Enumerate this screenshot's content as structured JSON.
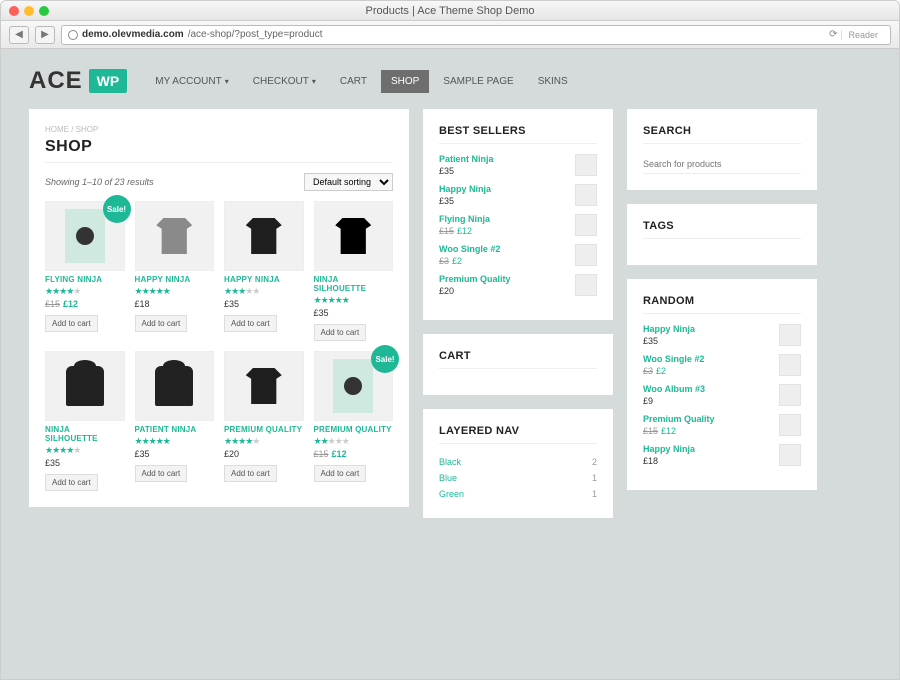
{
  "window": {
    "title": "Products | Ace Theme Shop Demo"
  },
  "url": {
    "host": "demo.olevmedia.com",
    "path": "/ace-shop/?post_type=product",
    "reader": "Reader"
  },
  "logo": {
    "text1": "ACE",
    "text2": "WP"
  },
  "menu": [
    {
      "label": "MY ACCOUNT",
      "dropdown": true
    },
    {
      "label": "CHECKOUT",
      "dropdown": true
    },
    {
      "label": "CART"
    },
    {
      "label": "SHOP",
      "active": true
    },
    {
      "label": "SAMPLE PAGE"
    },
    {
      "label": "SKINS"
    }
  ],
  "breadcrumb": "HOME / SHOP",
  "page_title": "SHOP",
  "results_text": "Showing 1–10 of 23 results",
  "sort_label": "Default sorting",
  "sale_badge": "Sale!",
  "add_to_cart": "Add to cart",
  "products": [
    {
      "name": "FLYING NINJA",
      "stars": 4,
      "old": "£15",
      "new": "£12",
      "sale": true,
      "img": "poster"
    },
    {
      "name": "HAPPY NINJA",
      "stars": 5,
      "price": "£18",
      "img": "tee-grey"
    },
    {
      "name": "HAPPY NINJA",
      "stars": 3,
      "price": "£35",
      "img": "tee-dark"
    },
    {
      "name": "NINJA SILHOUETTE",
      "stars": 5,
      "price": "£35",
      "img": "tee-black"
    },
    {
      "name": "NINJA SILHOUETTE",
      "stars": 4,
      "price": "£35",
      "img": "hoodie"
    },
    {
      "name": "PATIENT NINJA",
      "stars": 5,
      "price": "£35",
      "img": "hoodie"
    },
    {
      "name": "PREMIUM QUALITY",
      "stars": 4,
      "price": "£20",
      "img": "tee-dark"
    },
    {
      "name": "PREMIUM QUALITY",
      "stars": 2,
      "old": "£15",
      "new": "£12",
      "sale": true,
      "img": "poster"
    }
  ],
  "widgets": {
    "bestsellers": {
      "title": "BEST SELLERS",
      "items": [
        {
          "name": "Patient Ninja",
          "price": "£35"
        },
        {
          "name": "Happy Ninja",
          "price": "£35"
        },
        {
          "name": "Flying Ninja",
          "old": "£15",
          "new": "£12"
        },
        {
          "name": "Woo Single #2",
          "old": "£3",
          "new": "£2"
        },
        {
          "name": "Premium Quality",
          "price": "£20"
        }
      ]
    },
    "cart": {
      "title": "CART"
    },
    "layered": {
      "title": "LAYERED NAV",
      "items": [
        {
          "label": "Black",
          "count": "2"
        },
        {
          "label": "Blue",
          "count": "1"
        },
        {
          "label": "Green",
          "count": "1"
        }
      ]
    },
    "search": {
      "title": "SEARCH",
      "placeholder": "Search for products"
    },
    "tags": {
      "title": "TAGS"
    },
    "random": {
      "title": "RANDOM",
      "items": [
        {
          "name": "Happy Ninja",
          "price": "£35"
        },
        {
          "name": "Woo Single #2",
          "old": "£3",
          "new": "£2"
        },
        {
          "name": "Woo Album #3",
          "price": "£9"
        },
        {
          "name": "Premium Quality",
          "old": "£15",
          "new": "£12"
        },
        {
          "name": "Happy Ninja",
          "price": "£18"
        }
      ]
    }
  }
}
